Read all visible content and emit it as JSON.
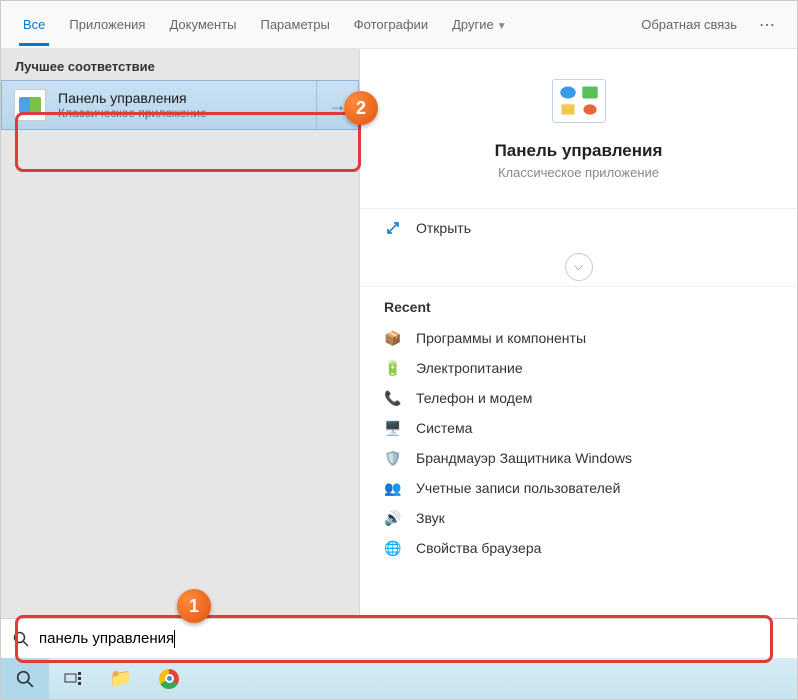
{
  "tabs": {
    "all": "Все",
    "apps": "Приложения",
    "docs": "Документы",
    "params": "Параметры",
    "photos": "Фотографии",
    "more": "Другие"
  },
  "header": {
    "feedback": "Обратная связь"
  },
  "best_match": {
    "label": "Лучшее соответствие"
  },
  "result": {
    "title": "Панель управления",
    "subtitle": "Классическое приложение"
  },
  "detail": {
    "title": "Панель управления",
    "subtitle": "Классическое приложение",
    "open": "Открыть",
    "recent_label": "Recent",
    "recent": [
      "Программы и компоненты",
      "Электропитание",
      "Телефон и модем",
      "Система",
      "Брандмауэр Защитника Windows",
      "Учетные записи пользователей",
      "Звук",
      "Свойства браузера"
    ]
  },
  "search": {
    "value": "панель управления"
  },
  "badges": {
    "one": "1",
    "two": "2"
  },
  "colors": {
    "accent": "#0078d4",
    "highlight": "#e13a3a",
    "badge": "#e05510"
  }
}
